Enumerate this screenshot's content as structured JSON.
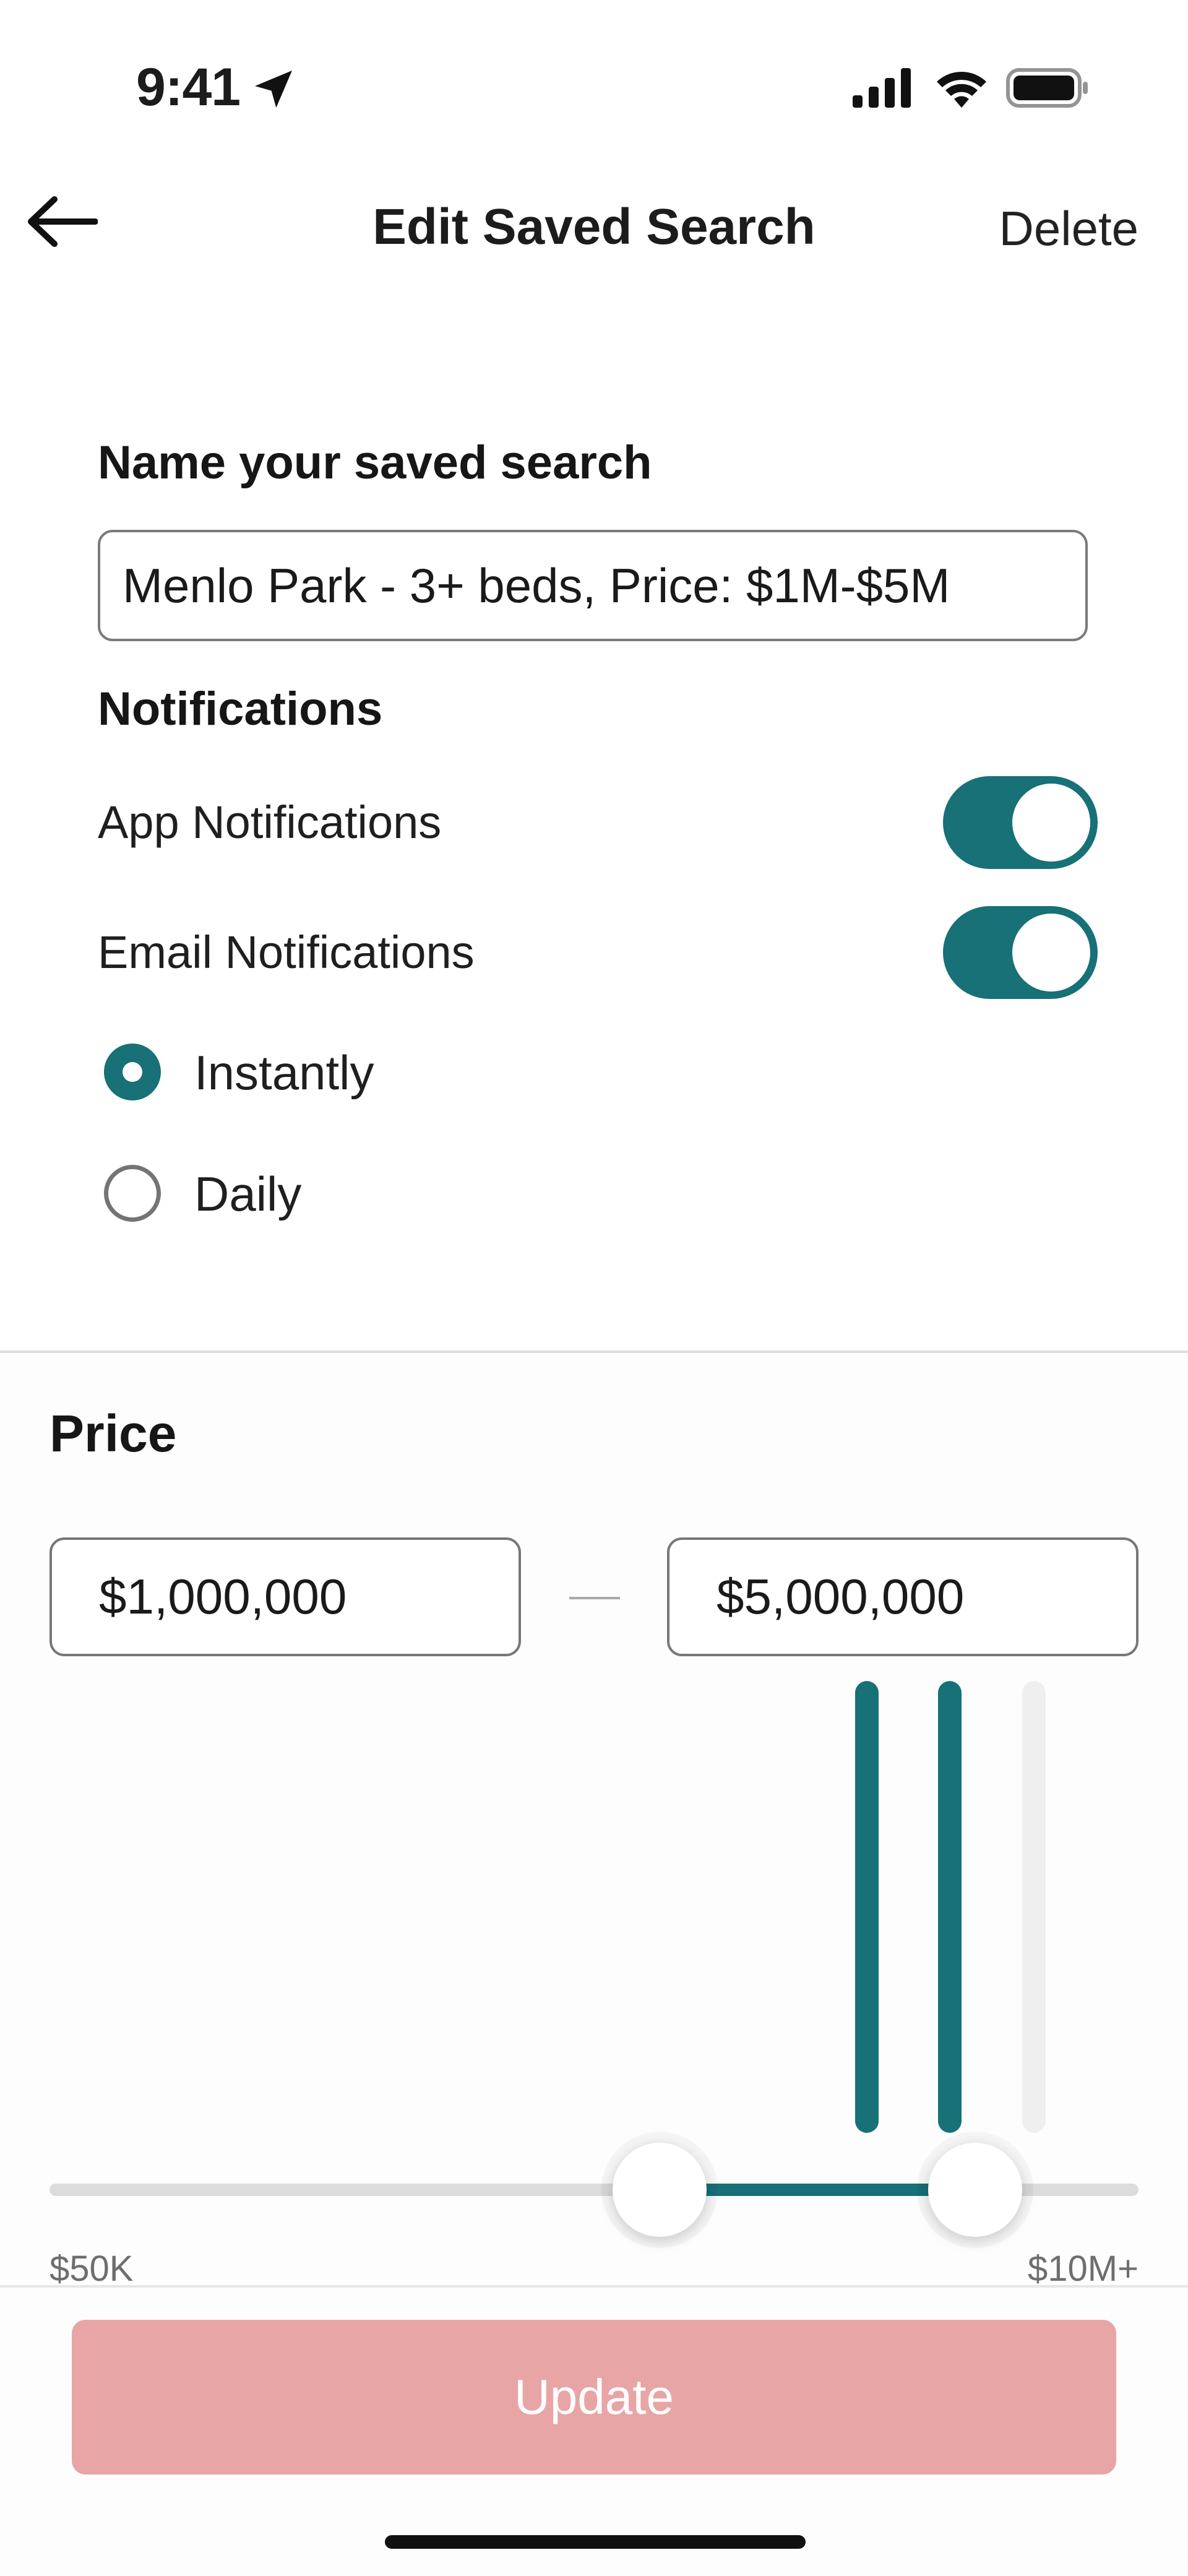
{
  "status_bar": {
    "time": "9:41",
    "icons": [
      "location-arrow-icon",
      "cellular-signal-icon",
      "wifi-icon",
      "battery-icon"
    ]
  },
  "nav": {
    "back_icon": "arrow-left-icon",
    "title": "Edit Saved Search",
    "delete_label": "Delete"
  },
  "saved_search": {
    "name_label": "Name your saved search",
    "name_value": "Menlo Park - 3+ beds, Price: $1M-$5M"
  },
  "notifications": {
    "heading": "Notifications",
    "app_label": "App Notifications",
    "app_enabled": true,
    "email_label": "Email Notifications",
    "email_enabled": true,
    "frequency_options": [
      {
        "label": "Instantly",
        "selected": true
      },
      {
        "label": "Daily",
        "selected": false
      }
    ]
  },
  "price": {
    "heading": "Price",
    "min_value": "$1,000,000",
    "max_value": "$5,000,000",
    "range_min_label": "$50K",
    "range_max_label": "$10M+",
    "slider_low_fraction": 0.56,
    "slider_high_fraction": 0.85,
    "histogram": [
      {
        "level": 1.0,
        "in_range": true
      },
      {
        "level": 1.0,
        "in_range": true
      },
      {
        "level": 1.0,
        "in_range": false
      }
    ]
  },
  "footer": {
    "update_label": "Update"
  },
  "colors": {
    "accent": "#177177",
    "update_button": "#e8a5a6",
    "histogram_inactive": "#efefef"
  }
}
